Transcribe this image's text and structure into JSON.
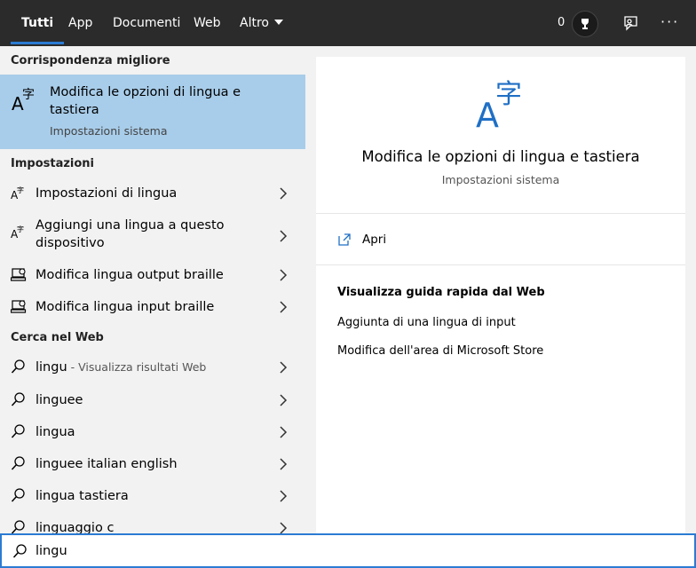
{
  "tabs": [
    {
      "label": "Tutti",
      "active": true
    },
    {
      "label": "App"
    },
    {
      "label": "Documenti"
    },
    {
      "label": "Web"
    },
    {
      "label": "Altro"
    }
  ],
  "rewards_points": "0",
  "more_label": "···",
  "sections": {
    "best": "Corrispondenza migliore",
    "settings": "Impostazioni",
    "web": "Cerca nel Web"
  },
  "best_match": {
    "title": "Modifica le opzioni di lingua e tastiera",
    "subtitle": "Impostazioni sistema",
    "icon": "language-icon"
  },
  "settings_items": [
    {
      "label": "Impostazioni di lingua",
      "icon": "language-icon"
    },
    {
      "label": "Aggiungi una lingua a questo dispositivo",
      "icon": "language-icon"
    },
    {
      "label": "Modifica lingua output braille",
      "icon": "braille-icon"
    },
    {
      "label": "Modifica lingua input braille",
      "icon": "braille-icon"
    }
  ],
  "web_items": [
    {
      "label": "lingu",
      "hint": " - Visualizza risultati Web"
    },
    {
      "label": "linguee"
    },
    {
      "label": "lingua"
    },
    {
      "label": "linguee italian english"
    },
    {
      "label": "lingua tastiera"
    },
    {
      "label": "linguaggio c"
    }
  ],
  "detail": {
    "title": "Modifica le opzioni di lingua e tastiera",
    "subtitle": "Impostazioni sistema",
    "open_label": "Apri",
    "guide_title": "Visualizza guida rapida dal Web",
    "links": [
      "Aggiunta di una lingua di input",
      "Modifica dell'area di Microsoft Store"
    ]
  },
  "search": {
    "value": "lingu"
  },
  "colors": {
    "accent": "#2b7bd3",
    "topbar": "#2b2b2b",
    "selected": "#a8cdea"
  }
}
